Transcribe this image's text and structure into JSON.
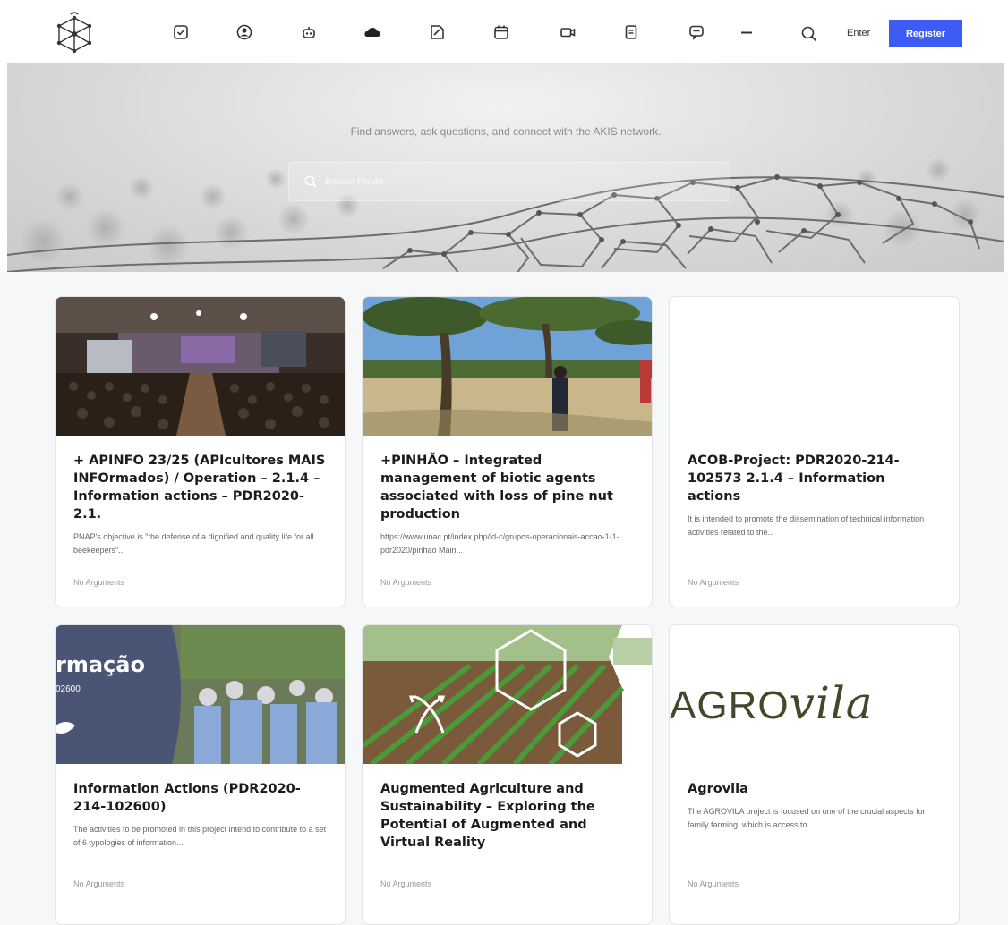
{
  "header": {
    "nav_icons": [
      "checkbox-icon",
      "user-circle-icon",
      "robot-icon",
      "cloud-icon",
      "note-icon",
      "calendar-icon",
      "video-icon",
      "document-icon",
      "chat-icon",
      "more-icon"
    ],
    "enter_label": "Enter",
    "register_label": "Register",
    "accent": "#3d5cf5"
  },
  "hero": {
    "tagline": "Find answers, ask questions, and connect with the AKIS network.",
    "search_placeholder": "Browse Forum..."
  },
  "cards": [
    {
      "title": "+ APINFO 23/25 (APIcultores MAIS INFOrmados) / Operation – 2.1.4 – Information actions – PDR2020-2.1.",
      "excerpt": "PNAP's objective is \"the defense of a dignified and quality life for all beekeepers\"...",
      "meta": "No Arguments",
      "image": "conference-hall"
    },
    {
      "title": "+PINHÃO – Integrated management of biotic agents associated with loss of pine nut production",
      "excerpt": "https://www.unac.pt/index.php/id-c/grupos-operacionais-accao-1-1-pdr2020/pinhao Main...",
      "meta": "No Arguments",
      "image": "pine-forest"
    },
    {
      "title": "ACOB-Project: PDR2020-214-102573 2.1.4 – Information actions",
      "excerpt": "It is intended to promote the dissemination of technical information activities related to the...",
      "meta": "No Arguments",
      "image": "blank"
    },
    {
      "title": "Information Actions (PDR2020-214-102600)",
      "excerpt": "The activities to be promoted in this project intend to contribute to a set of 6 typologies of information...",
      "meta": "No Arguments",
      "image": "field-visit",
      "image_text": [
        "rmação",
        "02600"
      ]
    },
    {
      "title": "Augmented Agriculture and Sustainability – Exploring the Potential of Augmented and Virtual Reality",
      "excerpt": "",
      "meta": "No Arguments",
      "image": "crop-field"
    },
    {
      "title": "Agrovila",
      "excerpt": "The AGROVILA project is focused on one of the crucial aspects for family farming, which is access to...",
      "meta": "No Arguments",
      "image": "agrovila-logo",
      "image_text": [
        "AGRO",
        "vila"
      ]
    }
  ]
}
